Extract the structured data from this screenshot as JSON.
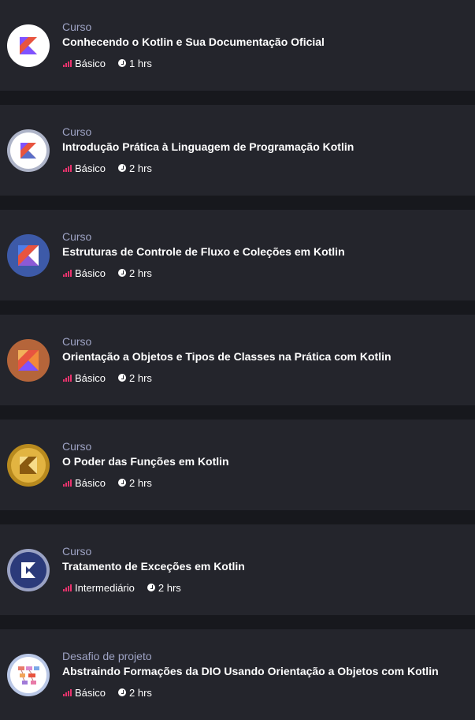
{
  "colors": {
    "accent_bars": "#e8336d",
    "page_bg": "#17181d",
    "card_bg": "#24252c",
    "kind_text": "#9ea3c4"
  },
  "courses": [
    {
      "kind": "Curso",
      "title": "Conhecendo o Kotlin e Sua Documentação Oficial",
      "level": "Básico",
      "duration": "1 hrs",
      "icon": "kotlin-logo-badge-white"
    },
    {
      "kind": "Curso",
      "title": "Introdução Prática à Linguagem de Programação Kotlin",
      "level": "Básico",
      "duration": "2 hrs",
      "icon": "kotlin-logo-badge-silver-ring"
    },
    {
      "kind": "Curso",
      "title": "Estruturas de Controle de Fluxo e Coleções em Kotlin",
      "level": "Básico",
      "duration": "2 hrs",
      "icon": "kotlin-logo-badge-blue-shield"
    },
    {
      "kind": "Curso",
      "title": "Orientação a Objetos e Tipos de Classes na Prática com Kotlin",
      "level": "Básico",
      "duration": "2 hrs",
      "icon": "kotlin-logo-badge-bronze-shield"
    },
    {
      "kind": "Curso",
      "title": "O Poder das Funções em Kotlin",
      "level": "Básico",
      "duration": "2 hrs",
      "icon": "kotlin-logo-badge-gold"
    },
    {
      "kind": "Curso",
      "title": "Tratamento de Exceções em Kotlin",
      "level": "Intermediário",
      "duration": "2 hrs",
      "icon": "kotlin-logo-badge-dark-blue"
    },
    {
      "kind": "Desafio de projeto",
      "title": "Abstraindo Formações da DIO Usando Orientação a Objetos com Kotlin",
      "level": "Básico",
      "duration": "2 hrs",
      "icon": "project-diagram-badge"
    }
  ]
}
